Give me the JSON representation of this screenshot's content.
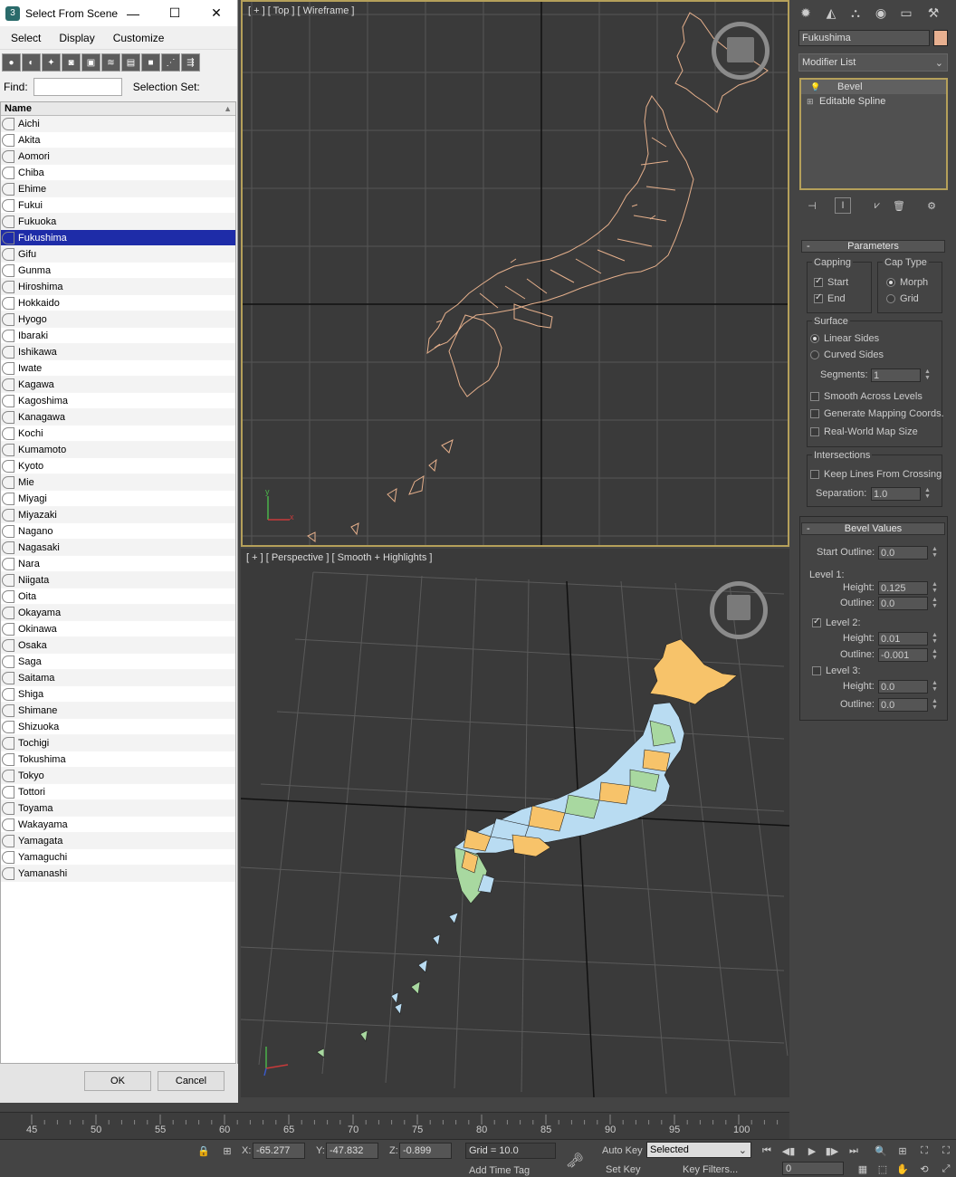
{
  "dialog": {
    "title": "Select From Scene",
    "menus": [
      "Select",
      "Display",
      "Customize"
    ],
    "find_label": "Find:",
    "selection_set_label": "Selection Set:",
    "column_header": "Name",
    "items": [
      "Aichi",
      "Akita",
      "Aomori",
      "Chiba",
      "Ehime",
      "Fukui",
      "Fukuoka",
      "Fukushima",
      "Gifu",
      "Gunma",
      "Hiroshima",
      "Hokkaido",
      "Hyogo",
      "Ibaraki",
      "Ishikawa",
      "Iwate",
      "Kagawa",
      "Kagoshima",
      "Kanagawa",
      "Kochi",
      "Kumamoto",
      "Kyoto",
      "Mie",
      "Miyagi",
      "Miyazaki",
      "Nagano",
      "Nagasaki",
      "Nara",
      "Niigata",
      "Oita",
      "Okayama",
      "Okinawa",
      "Osaka",
      "Saga",
      "Saitama",
      "Shiga",
      "Shimane",
      "Shizuoka",
      "Tochigi",
      "Tokushima",
      "Tokyo",
      "Tottori",
      "Toyama",
      "Wakayama",
      "Yamagata",
      "Yamaguchi",
      "Yamanashi"
    ],
    "selected_item": "Fukushima",
    "ok_label": "OK",
    "cancel_label": "Cancel"
  },
  "viewports": {
    "top_label": "[ + ] [ Top ] [ Wireframe ]",
    "persp_label": "[ + ] [ Perspective ] [ Smooth + Highlights ]"
  },
  "command_panel": {
    "object_name": "Fukushima",
    "object_color": "#e8b090",
    "modifier_list": "Modifier List",
    "stack": [
      "Bevel",
      "Editable Spline"
    ],
    "parameters": {
      "title": "Parameters",
      "capping": "Capping",
      "start": "Start",
      "end": "End",
      "cap_type": "Cap Type",
      "morph": "Morph",
      "grid": "Grid",
      "surface": "Surface",
      "linear_sides": "Linear Sides",
      "curved_sides": "Curved Sides",
      "segments_label": "Segments:",
      "segments": "1",
      "smooth_across": "Smooth Across Levels",
      "gen_mapping": "Generate Mapping Coords.",
      "real_world": "Real-World Map Size",
      "intersections": "Intersections",
      "keep_lines": "Keep Lines From Crossing",
      "separation_label": "Separation:",
      "separation": "1.0"
    },
    "bevel_values": {
      "title": "Bevel Values",
      "start_outline_label": "Start Outline:",
      "start_outline": "0.0",
      "level1": "Level 1:",
      "level1_height": "0.125",
      "level1_outline": "0.0",
      "level2": "Level 2:",
      "level2_height": "0.01",
      "level2_outline": "-0.001",
      "level3": "Level 3:",
      "level3_height": "0.0",
      "level3_outline": "0.0",
      "height_label": "Height:",
      "outline_label": "Outline:"
    }
  },
  "timeline": {
    "ticks": [
      "45",
      "50",
      "55",
      "60",
      "65",
      "70",
      "75",
      "80",
      "85",
      "90",
      "95",
      "100"
    ]
  },
  "status": {
    "x_label": "X:",
    "x": "-65.277",
    "y_label": "Y:",
    "y": "-47.832",
    "z_label": "Z:",
    "z": "-0.899",
    "grid": "Grid = 10.0",
    "auto_key": "Auto Key",
    "set_key": "Set Key",
    "selected": "Selected",
    "key_filters": "Key Filters...",
    "add_time_tag": "Add Time Tag",
    "frame": "0"
  }
}
